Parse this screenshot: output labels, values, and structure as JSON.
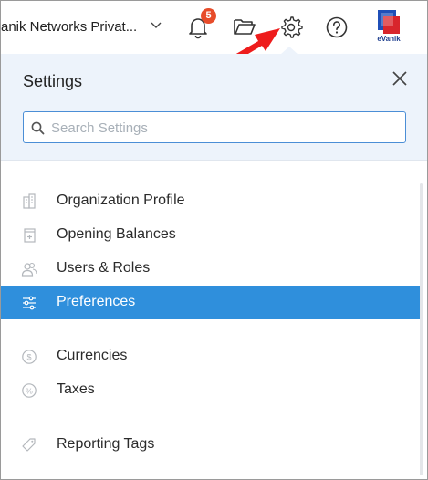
{
  "header": {
    "org_name": "anik Networks Privat...",
    "notification_count": "5",
    "avatar_label": "eVanik"
  },
  "settings_panel": {
    "title": "Settings",
    "search_placeholder": "Search Settings",
    "items": [
      {
        "label": "Organization Profile",
        "icon": "building-icon",
        "active": false
      },
      {
        "label": "Opening Balances",
        "icon": "ledger-icon",
        "active": false
      },
      {
        "label": "Users & Roles",
        "icon": "users-icon",
        "active": false
      },
      {
        "label": "Preferences",
        "icon": "sliders-icon",
        "active": true
      },
      {
        "label": "Currencies",
        "icon": "currency-icon",
        "active": false
      },
      {
        "label": "Taxes",
        "icon": "percent-icon",
        "active": false
      },
      {
        "label": "Reporting Tags",
        "icon": "tag-icon",
        "active": false
      }
    ]
  },
  "colors": {
    "accent": "#2f8fdc",
    "badge": "#e74c2a",
    "panel_header": "#edf3fb",
    "annotation_arrow": "#ee1c1c"
  }
}
